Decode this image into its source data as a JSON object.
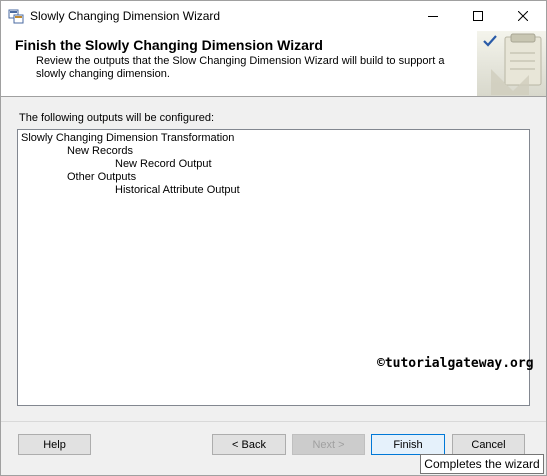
{
  "window": {
    "title": "Slowly Changing Dimension Wizard",
    "icon": "wizard-app-icon"
  },
  "header": {
    "title": "Finish the Slowly Changing Dimension Wizard",
    "description": "Review the outputs that the Slow Changing Dimension Wizard will build to support a slowly changing dimension.",
    "graphic": "checkmark-clipboard-graphic"
  },
  "main": {
    "outputs_label": "The following outputs will be configured:",
    "tree": [
      {
        "label": "Slowly Changing Dimension Transformation",
        "level": 0
      },
      {
        "label": "New Records",
        "level": 1
      },
      {
        "label": "New Record Output",
        "level": 2
      },
      {
        "label": "Other Outputs",
        "level": 1
      },
      {
        "label": "Historical Attribute Output",
        "level": 2
      }
    ]
  },
  "watermark": "©tutorialgateway.org",
  "buttons": {
    "help": "Help",
    "back": "< Back",
    "next": "Next >",
    "finish": "Finish",
    "cancel": "Cancel"
  },
  "tooltip": "Completes the wizard",
  "colors": {
    "focus_border": "#0078d7",
    "dialog_background": "#f0f0f0"
  }
}
